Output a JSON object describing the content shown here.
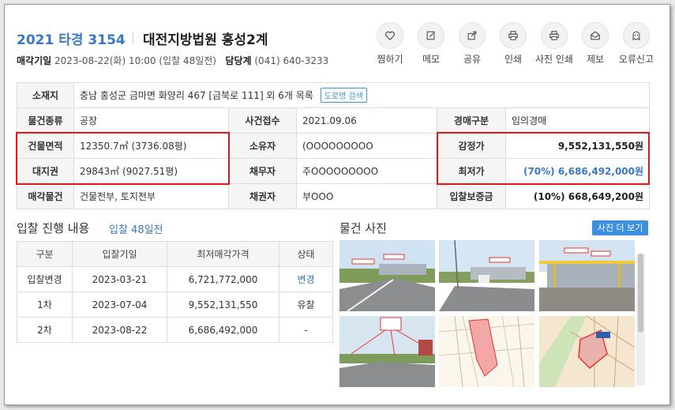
{
  "header": {
    "case_no": "2021 타경 3154",
    "court": "대전지방법원 홍성2계",
    "date_label": "매각기일",
    "date_value": "2023-08-22(화) 10:00 (입찰 48일전)",
    "contact_label": "담당계",
    "contact_value": "(041) 640-3233"
  },
  "actions": [
    {
      "label": "찜하기",
      "icon": "heart-icon"
    },
    {
      "label": "메모",
      "icon": "memo-icon"
    },
    {
      "label": "공유",
      "icon": "share-icon"
    },
    {
      "label": "인쇄",
      "icon": "print-icon"
    },
    {
      "label": "사진 인쇄",
      "icon": "photo-print-icon"
    },
    {
      "label": "제보",
      "icon": "report-icon"
    },
    {
      "label": "오류신고",
      "icon": "error-report-icon"
    }
  ],
  "info": {
    "location_label": "소재지",
    "location_value": "충남 홍성군 금마면 화양리 467 [금북로 111] 외 6개 목록",
    "road_search_label": "도로명 검색",
    "type_label": "물건종류",
    "type_value": "공장",
    "case_recv_label": "사건접수",
    "case_recv_value": "2021.09.06",
    "auction_type_label": "경매구분",
    "auction_type_value": "임의경매",
    "building_area_label": "건물면적",
    "building_area_value": "12350.7㎡ (3736.08평)",
    "owner_label": "소유자",
    "owner_value": "(OOOOOOOOO",
    "appraisal_label": "감정가",
    "appraisal_value": "9,552,131,550원",
    "land_label": "대지권",
    "land_value": "29843㎡ (9027.51평)",
    "debtor_label": "채무자",
    "debtor_value": "주OOOOOOOOO",
    "min_price_label": "최저가",
    "min_price_value": "(70%) 6,686,492,000원",
    "sale_items_label": "매각물건",
    "sale_items_value": "건물전부, 토지전부",
    "creditor_label": "채권자",
    "creditor_value": "부OOO",
    "deposit_label": "입찰보증금",
    "deposit_value": "(10%) 668,649,200원"
  },
  "bid_section": {
    "title": "입찰 진행 내용",
    "subtitle": "입찰 48일전",
    "columns": [
      "구분",
      "입찰기일",
      "최저매각가격",
      "상태"
    ],
    "rows": [
      [
        "입찰변경",
        "2023-03-21",
        "6,721,772,000",
        "변경"
      ],
      [
        "1차",
        "2023-07-04",
        "9,552,131,550",
        "유찰"
      ],
      [
        "2차",
        "2023-08-22",
        "6,686,492,000",
        "-"
      ]
    ]
  },
  "photo_section": {
    "title": "물건 사진",
    "more_label": "사진 더 보기"
  },
  "colors": {
    "accent": "#3a78c9",
    "highlight_border": "#e8141a",
    "button": "#3a8fe0"
  }
}
